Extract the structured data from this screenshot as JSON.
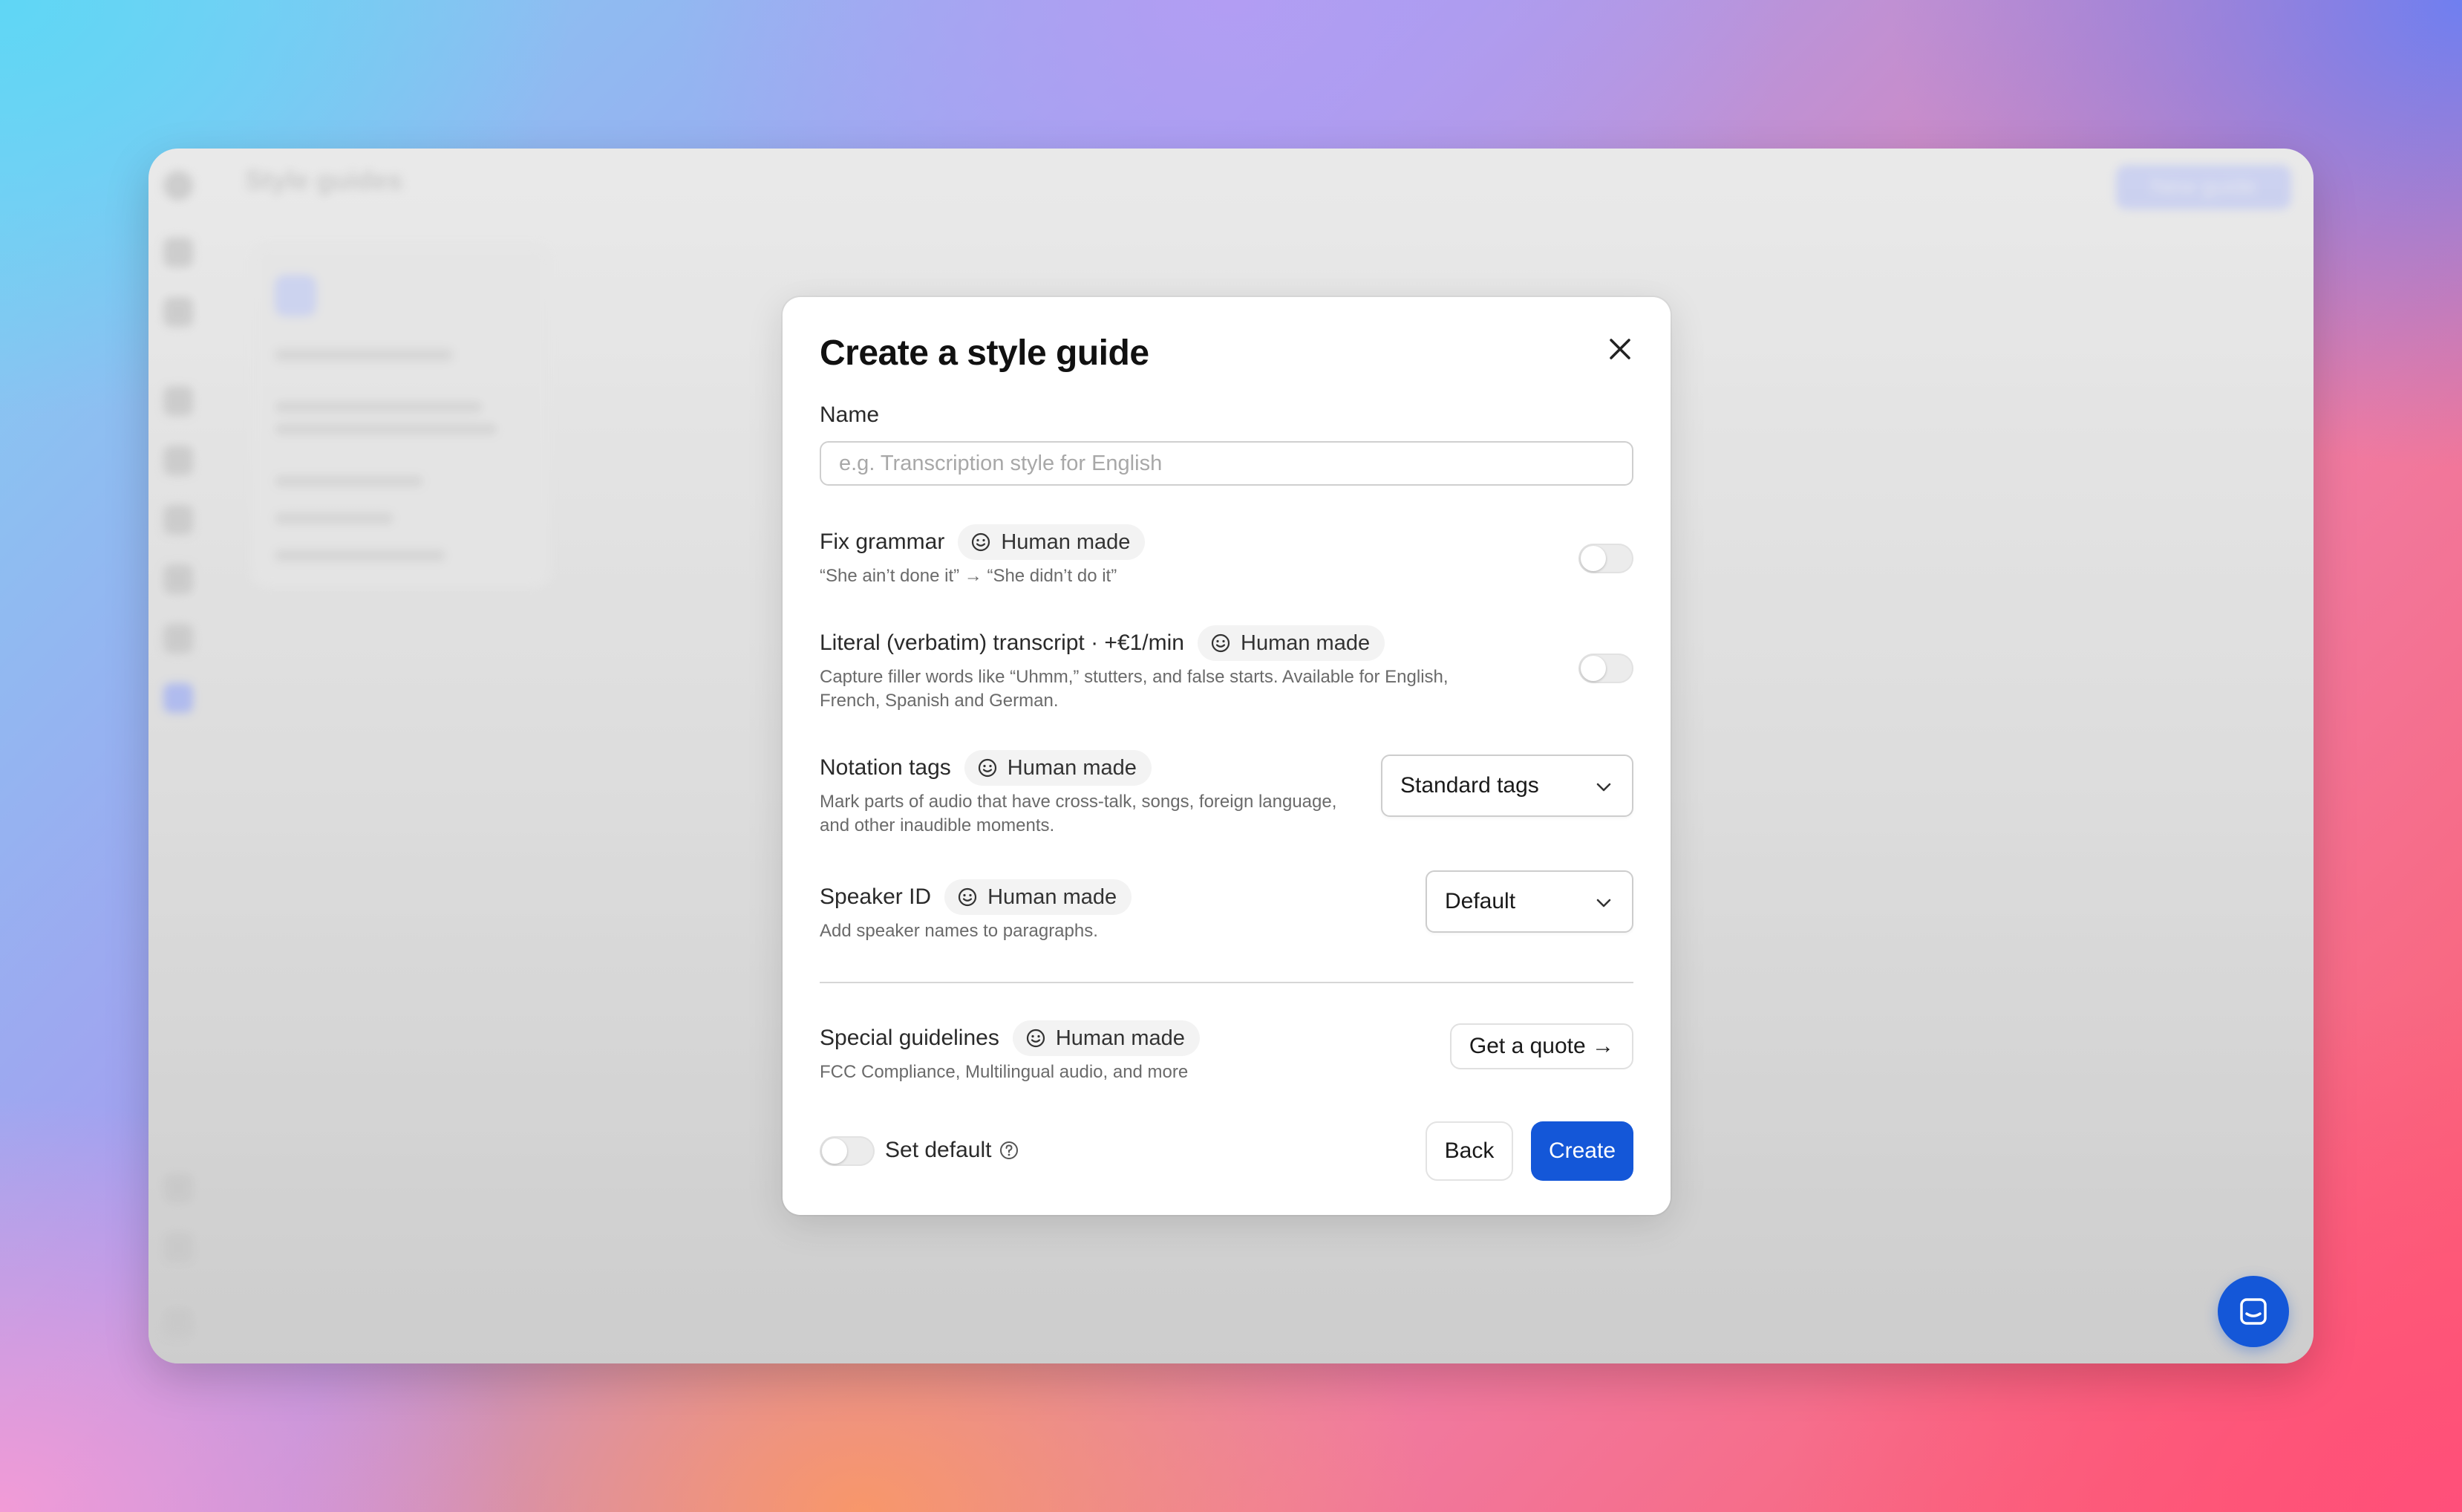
{
  "background_app": {
    "title": "Style guides",
    "new_button_label": "New guide"
  },
  "modal": {
    "title": "Create a style guide",
    "name_label": "Name",
    "name_value": "",
    "name_placeholder": "e.g. Transcription style for English",
    "options": [
      {
        "title": "Fix grammar",
        "badge": "Human made",
        "description": "“She ain’t done it” → “She didn’t do it”",
        "control": "toggle",
        "enabled": false
      },
      {
        "title": "Literal (verbatim) transcript · +€1/min",
        "badge": "Human made",
        "description": "Capture filler words like “Uhmm,” stutters, and false starts. Available for English, French, Spanish and German.",
        "control": "toggle",
        "enabled": false
      },
      {
        "title": "Notation tags",
        "badge": "Human made",
        "description": "Mark parts of audio that have cross-talk, songs, foreign language, and other inaudible moments.",
        "control": "select",
        "selected": "Standard tags"
      },
      {
        "title": "Speaker ID",
        "badge": "Human made",
        "description": "Add speaker names to paragraphs.",
        "control": "select",
        "selected": "Default"
      }
    ],
    "special": {
      "title": "Special guidelines",
      "badge": "Human made",
      "description": "FCC Compliance, Multilingual audio, and more",
      "button_label": "Get a quote →"
    },
    "footer": {
      "set_default_label": "Set default",
      "set_default_enabled": false,
      "back_label": "Back",
      "create_label": "Create"
    }
  },
  "icons": {
    "badge": "smiley-icon",
    "close": "close-icon",
    "chevron": "chevron-down-icon",
    "help": "question-circle-icon",
    "chat": "chat-icon"
  },
  "colors": {
    "primary": "#1457d8",
    "badge_bg": "#f3f3f3",
    "toggle_off": "#ececec"
  }
}
